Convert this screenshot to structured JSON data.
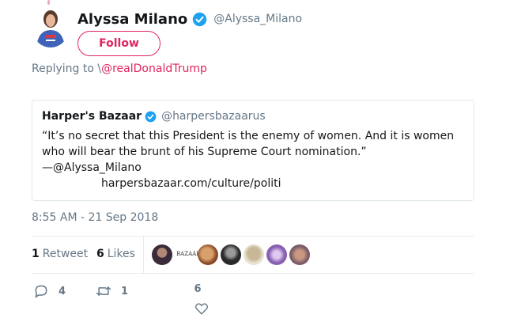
{
  "author": {
    "display_name": "Alyssa Milano",
    "handle": "@Alyssa_Milano",
    "follow_label": "Follow"
  },
  "reply": {
    "prefix": "Replying to",
    "mention": "@realDonaldTrump"
  },
  "quote": {
    "name": "Harper's Bazaar",
    "handle": "@harpersbazaarus",
    "text": "“It’s no secret that this President is the enemy of women. And it is women who will bear the brunt of his Supreme Court nomination.”",
    "byline": "—@Alyssa_Milano",
    "link": "harpersbazaar.com/culture/politi"
  },
  "timestamp": "8:55 AM - 21 Sep 2018",
  "stats": {
    "retweets_count": "1",
    "retweets_label": "Retweet",
    "likes_count": "6",
    "likes_label": "Likes",
    "liker_text": "BAZAAR"
  },
  "actions": {
    "reply_count": "4",
    "retweet_count": "1",
    "like_count": "6"
  },
  "colors": {
    "accent": "#e0245e",
    "verified": "#1da1f2",
    "muted": "#657786",
    "text": "#14171a",
    "border": "#e6ecf0"
  },
  "icons": {
    "verified": "verified-badge-icon",
    "reply": "reply-icon",
    "retweet": "retweet-icon",
    "like": "heart-icon"
  }
}
